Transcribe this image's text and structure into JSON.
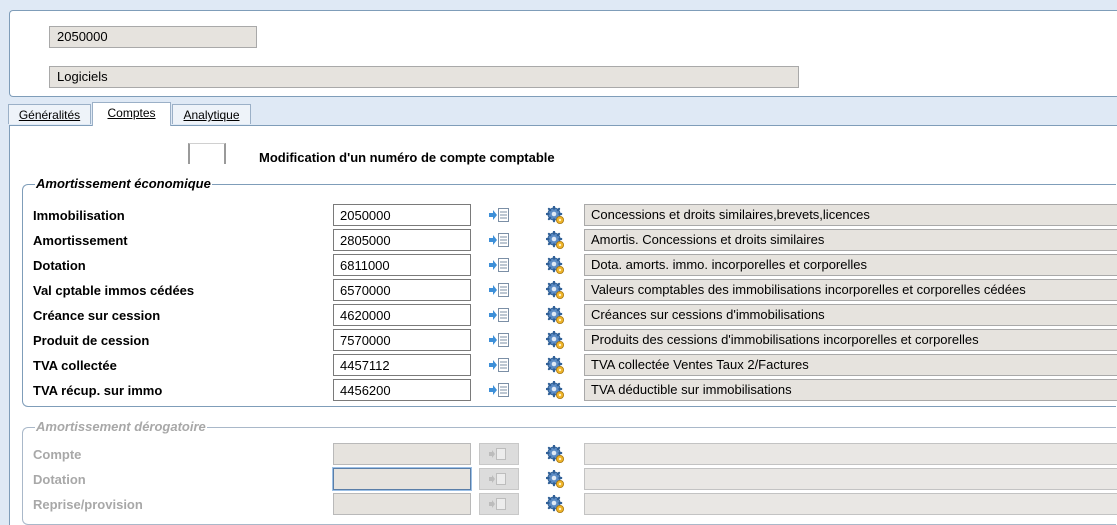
{
  "header": {
    "code": "2050000",
    "label": "Logiciels"
  },
  "tabs": [
    {
      "label": "Généralités",
      "active": false
    },
    {
      "label": "Comptes",
      "active": true
    },
    {
      "label": "Analytique",
      "active": false
    }
  ],
  "modification": {
    "label": "Modification d'un numéro de compte comptable",
    "checked": false
  },
  "economic": {
    "legend": "Amortissement économique",
    "rows": [
      {
        "label": "Immobilisation",
        "account": "2050000",
        "description": "Concessions et droits similaires,brevets,licences"
      },
      {
        "label": "Amortissement",
        "account": "2805000",
        "description": "Amortis. Concessions et droits similaires"
      },
      {
        "label": "Dotation",
        "account": "6811000",
        "description": "Dota. amorts. immo. incorporelles et corporelles"
      },
      {
        "label": "Val cptable immos cédées",
        "account": "6570000",
        "description": "Valeurs comptables des immobilisations incorporelles et corporelles cédées"
      },
      {
        "label": "Créance sur cession",
        "account": "4620000",
        "description": "Créances sur cessions d'immobilisations"
      },
      {
        "label": "Produit de cession",
        "account": "7570000",
        "description": "Produits des cessions d'immobilisations incorporelles et corporelles"
      },
      {
        "label": "TVA collectée",
        "account": "4457112",
        "description": "TVA collectée Ventes Taux 2/Factures"
      },
      {
        "label": "TVA récup. sur immo",
        "account": "4456200",
        "description": "TVA déductible sur immobilisations"
      }
    ]
  },
  "derogatory": {
    "legend": "Amortissement dérogatoire",
    "rows": [
      {
        "label": "Compte",
        "account": "",
        "description": ""
      },
      {
        "label": "Dotation",
        "account": "",
        "description": ""
      },
      {
        "label": "Reprise/provision",
        "account": "",
        "description": ""
      }
    ]
  },
  "icons": {
    "list": "list-arrow-icon",
    "gear": "gear-settings-icon"
  },
  "colors": {
    "background": "#dfe9f5",
    "border": "#7f9db9",
    "readonly": "#e6e3de"
  }
}
